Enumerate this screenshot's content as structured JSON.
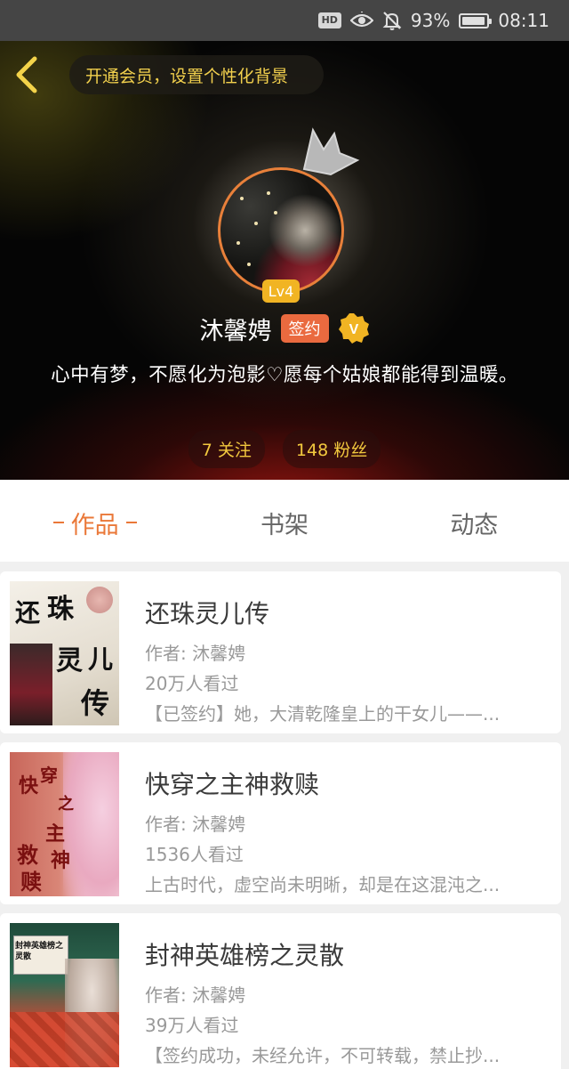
{
  "status_bar": {
    "hd_label": "HD",
    "battery_percent": "93%",
    "battery_level": 0.93,
    "time": "08:11"
  },
  "header": {
    "vip_prompt": "开通会员，设置个性化背景",
    "level": "Lv4",
    "name": "沐馨娉",
    "signed_label": "签约",
    "verified_mark": "V",
    "bio": "心中有梦，不愿化为泡影♡愿每个姑娘都能得到温暖。",
    "following": "7 关注",
    "followers": "148 粉丝"
  },
  "tabs": [
    {
      "label": "作品",
      "active": true
    },
    {
      "label": "书架",
      "active": false
    },
    {
      "label": "动态",
      "active": false
    }
  ],
  "books": [
    {
      "title": "还珠灵儿传",
      "author": "作者: 沐馨娉",
      "views": "20万人看过",
      "desc": "【已签约】她，大清乾隆皇上的干女儿——...",
      "cover_text": [
        "还",
        "珠",
        "灵",
        "儿",
        "传"
      ]
    },
    {
      "title": "快穿之主神救赎",
      "author": "作者: 沐馨娉",
      "views": "1536人看过",
      "desc": "上古时代，虚空尚未明晰，却是在这混沌之...",
      "cover_text": [
        "快",
        "穿",
        "之",
        "主",
        "神",
        "救",
        "赎"
      ]
    },
    {
      "title": "封神英雄榜之灵散",
      "author": "作者: 沐馨娉",
      "views": "39万人看过",
      "desc": "【签约成功，未经允许，不可转载，禁止抄...",
      "cover_text": "封神英雄榜之灵散"
    }
  ],
  "colors": {
    "accent": "#ea7838",
    "gold": "#f3c93e",
    "signed_badge": "#ea6a3f",
    "level_badge": "#f1b423"
  },
  "icons": {
    "back": "chevron-left-icon",
    "eye": "eye-icon",
    "mute": "bell-off-icon",
    "battery": "battery-icon",
    "crown": "crown-icon",
    "verified": "verified-badge-icon"
  }
}
